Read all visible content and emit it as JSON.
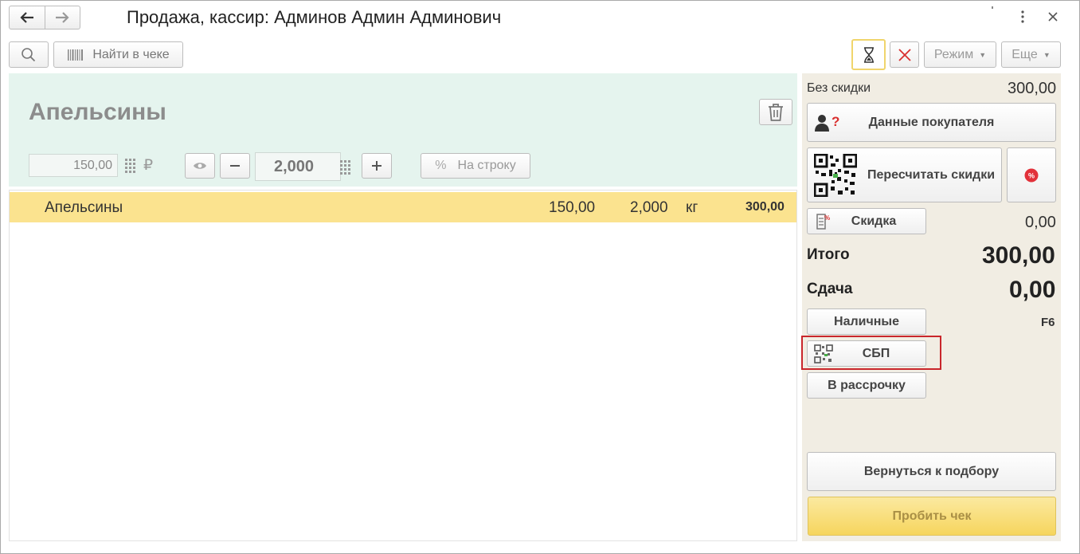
{
  "window": {
    "title": "Продажа, кассир: Админов Админ Админович"
  },
  "toolbar": {
    "find_label": "Найти в чеке",
    "mode_label": "Режим",
    "more_label": "Еще"
  },
  "item_panel": {
    "title": "Апельсины",
    "price": "150,00",
    "currency": "₽",
    "quantity": "2,000",
    "row_discount_label": "На строку"
  },
  "receipt_rows": [
    {
      "name": "Апельсины",
      "price": "150,00",
      "quantity": "2,000",
      "unit": "кг",
      "sum": "300,00"
    }
  ],
  "summary": {
    "no_discount_label": "Без скидки",
    "no_discount_value": "300,00",
    "customer_button": "Данные покупателя",
    "recalc_button": "Пересчитать скидки",
    "discount_button": "Скидка",
    "discount_value": "0,00",
    "total_label": "Итого",
    "total_value": "300,00",
    "change_label": "Сдача",
    "change_value": "0,00",
    "cash_button": "Наличные",
    "cash_hotkey": "F6",
    "sbp_button": "СБП",
    "installment_button": "В рассрочку",
    "back_button": "Вернуться к подбору",
    "pay_button": "Пробить чек"
  },
  "colors": {
    "item_panel_bg": "#e5f4ee",
    "selected_row_bg": "#fbe38f",
    "right_panel_bg": "#f1ede3",
    "highlight_border": "#c9262b",
    "pay_button_bg": "#f6d55d"
  }
}
